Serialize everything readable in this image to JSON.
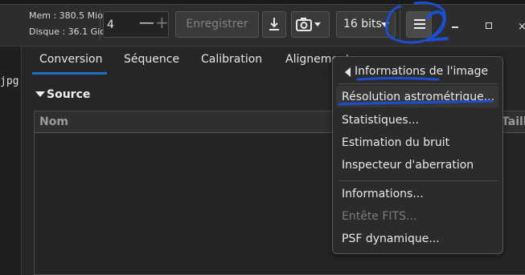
{
  "status": {
    "mem": "Mem : 380.5 Mio",
    "disk": "Disque : 36.1 Gio"
  },
  "toolbar": {
    "spin_value": "4",
    "minus": "—",
    "plus": "+",
    "save_label": "Enregistrer",
    "bits_label": "16 bits"
  },
  "window": {
    "close_glyph": "×"
  },
  "left": {
    "file_ext": "jpg"
  },
  "tabs": [
    {
      "label": "Conversion",
      "active": true
    },
    {
      "label": "Séquence"
    },
    {
      "label": "Calibration"
    },
    {
      "label": "Alignement"
    }
  ],
  "main": {
    "source_title": "Source",
    "col_name": "Nom",
    "col_size": "Taille"
  },
  "menu": {
    "back_label": "Informations de l'image",
    "items": [
      {
        "label": "Résolution astrométrique..."
      },
      {
        "label": "Statistiques..."
      },
      {
        "label": "Estimation du bruit"
      },
      {
        "label": "Inspecteur d'aberration"
      },
      {
        "label": "Informations..."
      },
      {
        "label": "Entête FITS...",
        "disabled": true
      },
      {
        "label": "PSF dynamique..."
      }
    ]
  },
  "colors": {
    "accent": "#1e6fc4",
    "annotation": "#1b4fd0"
  },
  "icons": [
    "download-icon",
    "camera-icon",
    "caret-down-icon",
    "hamburger-menu-icon",
    "minimize-icon",
    "maximize-icon",
    "close-icon",
    "triangle-left-icon",
    "triangle-down-icon"
  ]
}
